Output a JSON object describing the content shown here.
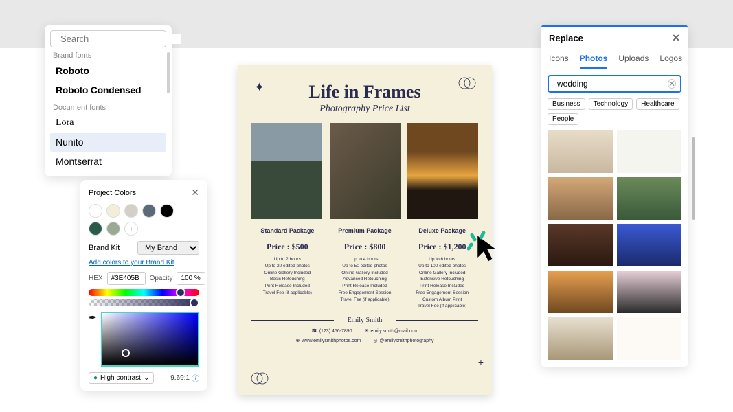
{
  "fontPanel": {
    "searchPlaceholder": "Search",
    "brandSection": "Brand fonts",
    "docSection": "Document fonts",
    "fonts": {
      "roboto": "Roboto",
      "robotoCond": "Roboto Condensed",
      "lora": "Lora",
      "nunito": "Nunito",
      "montserrat": "Montserrat"
    }
  },
  "colorPanel": {
    "title": "Project Colors",
    "swatchColors1": [
      "#ffffff",
      "#f2eed8",
      "#d4cfc7",
      "#5a6a7a",
      "#000000"
    ],
    "swatchColors2": [
      "#2a5a4a",
      "#9aaa92"
    ],
    "brandKitLabel": "Brand Kit",
    "brandKitValue": "My Brand",
    "brandLink": "Add colors to your Brand Kit",
    "hexLabel": "HEX",
    "hexValue": "#3E405B",
    "opacityLabel": "Opacity",
    "opacityValue": "100 %",
    "contrastLabel": "High contrast",
    "contrastScore": "9.69:1"
  },
  "document": {
    "title": "Life in Frames",
    "subtitle": "Photography Price List",
    "packages": [
      {
        "name": "Standard Package",
        "price": "Price : $500",
        "features": [
          "Up to 2 hours",
          "Up to 20 edited photos",
          "Online Gallery Included",
          "Basic Retouching",
          "Print Release Included",
          "Travel Fee (if applicable)"
        ]
      },
      {
        "name": "Premium Package",
        "price": "Price : $800",
        "features": [
          "Up to 4 hours",
          "Up to 50 edited photos",
          "Online Gallery Included",
          "Advanced Retouching",
          "Print Release Included",
          "Free Engagement Session",
          "Travel Fee (if applicable)"
        ]
      },
      {
        "name": "Deluxe Package",
        "price": "Price : $1,200",
        "features": [
          "Up to 6 hours",
          "Up to 100 edited photos",
          "Online Gallery Included",
          "Extensive Retouching",
          "Print Release Included",
          "Free Engagement Session",
          "Custom Album Print",
          "Travel Fee (if applicable)"
        ]
      }
    ],
    "footerName": "Emily Smith",
    "contacts": {
      "phone": "(123) 456-7890",
      "email": "emily.smith@mail.com",
      "website": "www.emilysmithphotos.com",
      "instagram": "@emilysmithphotography"
    }
  },
  "replacePanel": {
    "title": "Replace",
    "tabs": {
      "icons": "Icons",
      "photos": "Photos",
      "uploads": "Uploads",
      "logos": "Logos"
    },
    "searchValue": "wedding",
    "chips": [
      "Business",
      "Technology",
      "Healthcare",
      "People"
    ]
  }
}
